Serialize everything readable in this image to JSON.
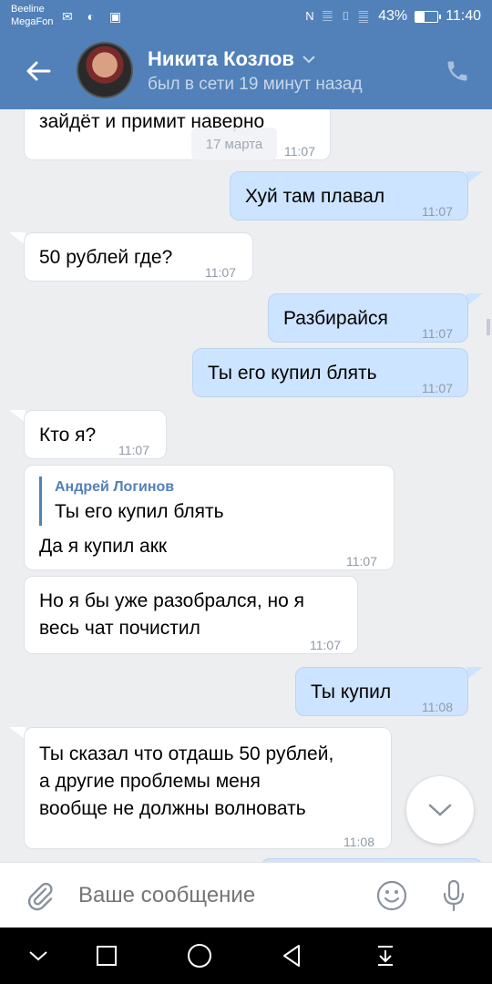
{
  "status_bar": {
    "carrier1": "Beeline",
    "carrier2": "MegaFon",
    "left_icons": "✉ ◐ ▣",
    "icons": "N 𝄚 ▯ 𝄛",
    "battery_percent": "43%",
    "battery_level": 0.43,
    "time": "11:40"
  },
  "header": {
    "contact_name": "Никита Козлов",
    "status": "был в сети 19 минут назад",
    "back_icon": "arrow-left-icon",
    "call_icon": "phone-icon",
    "dropdown_icon": "chevron-down-icon"
  },
  "messages": [
    {
      "dir": "in",
      "text": "зайдёт и примит наверно",
      "time": "11:07"
    },
    {
      "dir": "out",
      "text": "Хуй там плавал",
      "time": "11:07"
    },
    {
      "dir": "in",
      "text": "50 рублей где?",
      "time": "11:07"
    },
    {
      "dir": "out",
      "text": "Разбирайся",
      "time": "11:07"
    },
    {
      "dir": "out",
      "text": "Ты его купил блять",
      "time": "11:07"
    },
    {
      "dir": "in",
      "text": "Кто я?",
      "time": "11:07"
    },
    {
      "dir": "in",
      "quote_author": "Андрей Логинов",
      "quote_text": "Ты его купил блять",
      "text": "Да я купил акк",
      "time": "11:07"
    },
    {
      "dir": "in",
      "lines": [
        "Но я бы уже разобрался, но я",
        "весь чат почистил"
      ],
      "time": "11:07"
    },
    {
      "dir": "out",
      "text": "Ты купил",
      "time": "11:08"
    },
    {
      "dir": "in",
      "lines": [
        "Ты сказал что отдашь 50 рублей,",
        "а другие проблемы меня",
        "вообще не должны волновать"
      ],
      "time": "11:08"
    }
  ],
  "date_badge": "17 марта",
  "input": {
    "placeholder": "Ваше сообщение",
    "attach_icon": "paperclip-icon",
    "emoji_icon": "smiley-icon",
    "mic_icon": "microphone-icon"
  },
  "colors": {
    "header_bg": "#5181b8",
    "chat_bg": "#edeef0",
    "out_bubble": "#cce4ff",
    "in_bubble": "#ffffff",
    "time_text": "#8f9aa6"
  },
  "nav": {
    "icons": [
      "chevron-down-icon",
      "recents-square-icon",
      "home-circle-icon",
      "back-triangle-icon",
      "notification-pull-icon"
    ]
  }
}
